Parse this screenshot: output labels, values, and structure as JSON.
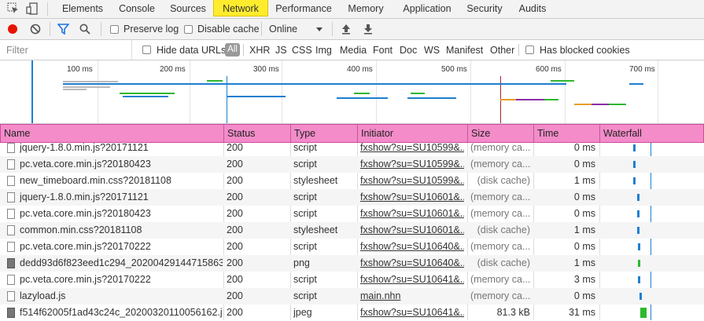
{
  "tabs": [
    "Elements",
    "Console",
    "Sources",
    "Network",
    "Performance",
    "Memory",
    "Application",
    "Security",
    "Audits"
  ],
  "active_tab": "Network",
  "toolbar": {
    "preserve_log": "Preserve log",
    "disable_cache": "Disable cache",
    "throttle": "Online"
  },
  "filter": {
    "placeholder": "Filter",
    "hide_data_urls": "Hide data URLs",
    "all": "All",
    "types": [
      "XHR",
      "JS",
      "CSS",
      "Img",
      "Media",
      "Font",
      "Doc",
      "WS",
      "Manifest",
      "Other"
    ],
    "has_blocked_cookies": "Has blocked cookies"
  },
  "overview": {
    "ticks": [
      "100 ms",
      "200 ms",
      "300 ms",
      "400 ms",
      "500 ms",
      "600 ms",
      "700 ms"
    ]
  },
  "columns": [
    "Name",
    "Status",
    "Type",
    "Initiator",
    "Size",
    "Time",
    "Waterfall"
  ],
  "rows": [
    {
      "name": "jquery-1.8.0.min.js?20171121",
      "status": "200",
      "type": "script",
      "initiator": "fxshow?su=SU10599&...",
      "size": "(memory ca...",
      "time": "0 ms",
      "icon": "doc",
      "wf": 0.33
    },
    {
      "name": "pc.veta.core.min.js?20180423",
      "status": "200",
      "type": "script",
      "initiator": "fxshow?su=SU10599&...",
      "size": "(memory ca...",
      "time": "0 ms",
      "icon": "doc",
      "wf": 0.33
    },
    {
      "name": "new_timeboard.min.css?20181108",
      "status": "200",
      "type": "stylesheet",
      "initiator": "fxshow?su=SU10599&...",
      "size": "(disk cache)",
      "time": "1 ms",
      "icon": "doc",
      "wf": 0.33
    },
    {
      "name": "jquery-1.8.0.min.js?20171121",
      "status": "200",
      "type": "script",
      "initiator": "fxshow?su=SU10601&...",
      "size": "(memory ca...",
      "time": "0 ms",
      "icon": "doc",
      "wf": 0.37
    },
    {
      "name": "pc.veta.core.min.js?20180423",
      "status": "200",
      "type": "script",
      "initiator": "fxshow?su=SU10601&...",
      "size": "(memory ca...",
      "time": "0 ms",
      "icon": "doc",
      "wf": 0.37
    },
    {
      "name": "common.min.css?20181108",
      "status": "200",
      "type": "stylesheet",
      "initiator": "fxshow?su=SU10601&...",
      "size": "(disk cache)",
      "time": "1 ms",
      "icon": "doc",
      "wf": 0.37
    },
    {
      "name": "pc.veta.core.min.js?20170222",
      "status": "200",
      "type": "script",
      "initiator": "fxshow?su=SU10640&...",
      "size": "(memory ca...",
      "time": "0 ms",
      "icon": "doc",
      "wf": 0.38
    },
    {
      "name": "dedd93d6f823eed1c294_20200429144715863...",
      "status": "200",
      "type": "png",
      "initiator": "fxshow?su=SU10640&...",
      "size": "(disk cache)",
      "time": "1 ms",
      "icon": "img",
      "wf": 0.38
    },
    {
      "name": "pc.veta.core.min.js?20170222",
      "status": "200",
      "type": "script",
      "initiator": "fxshow?su=SU10641&...",
      "size": "(memory ca...",
      "time": "3 ms",
      "icon": "doc",
      "wf": 0.38
    },
    {
      "name": "lazyload.js",
      "status": "200",
      "type": "script",
      "initiator": "main.nhn",
      "size": "(memory ca...",
      "time": "0 ms",
      "icon": "doc",
      "wf": 0.39
    },
    {
      "name": "f514f62005f1ad43c24c_20200320110056162.j...",
      "status": "200",
      "type": "jpeg",
      "initiator": "fxshow?su=SU10641&...",
      "size": "81.3 kB",
      "time": "31 ms",
      "icon": "img",
      "wf": 0.4
    }
  ],
  "colors": {
    "active_tab": "#ffec2d",
    "header_highlight": "#f38cc9",
    "record": "#e51400",
    "filter_blue": "#1a73e8",
    "bar_blue": "#1f7fd0",
    "bar_green": "#2eb82e"
  }
}
